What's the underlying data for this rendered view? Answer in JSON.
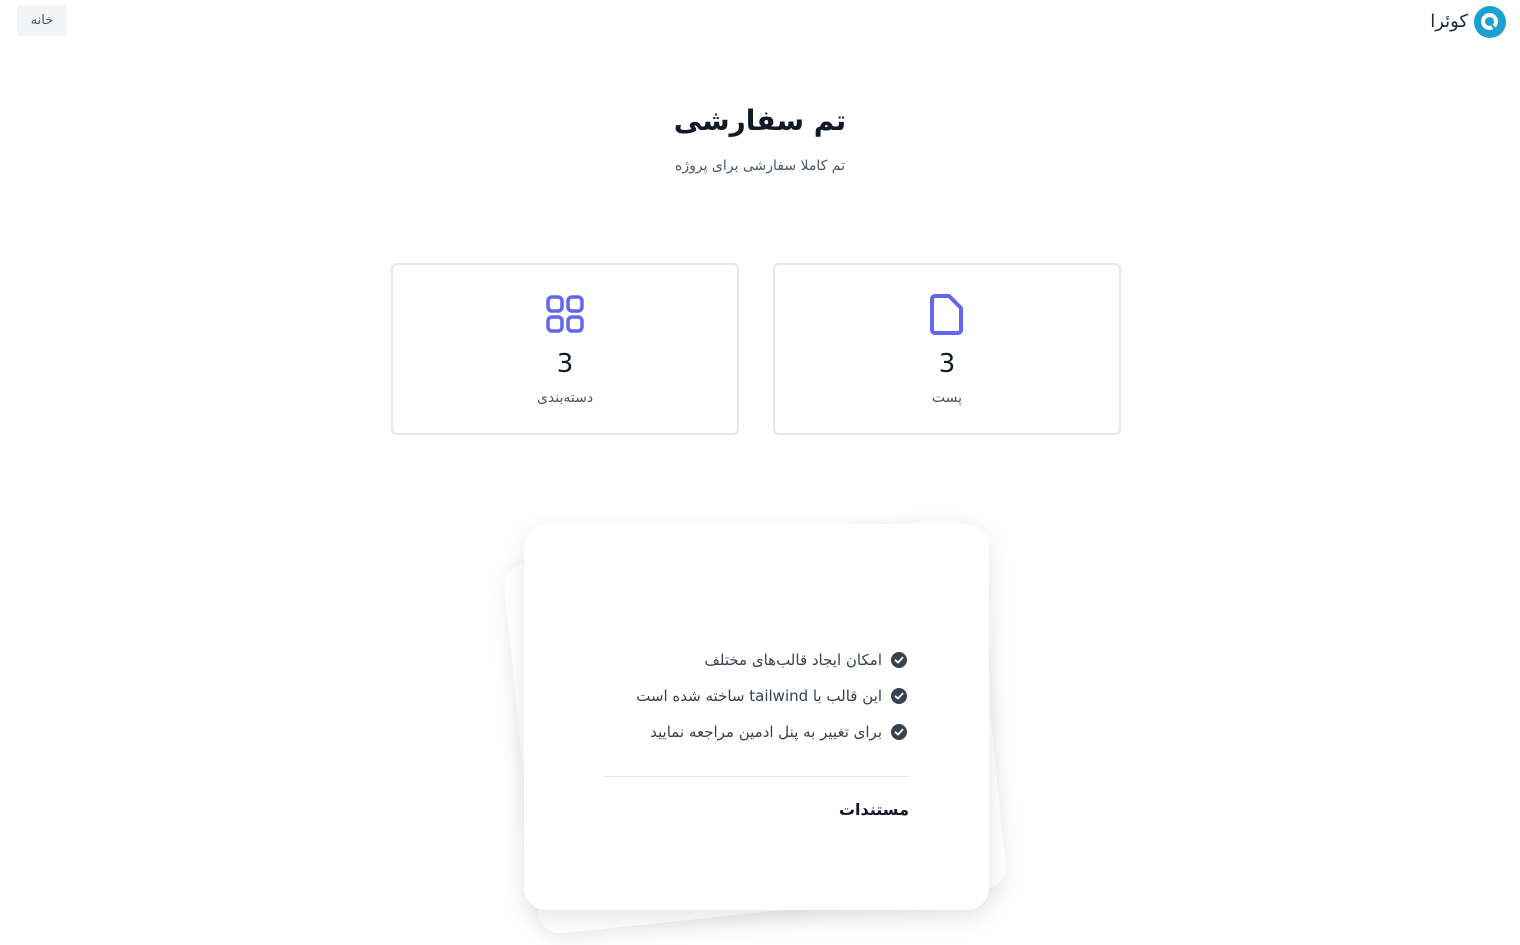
{
  "header": {
    "brand_name": "کوئرا",
    "brand_logo_icon": "quera-logo-icon",
    "home_label": "خانه"
  },
  "hero": {
    "title": "تم سفارشی",
    "subtitle": "تم کاملا سفارشی برای پروژه"
  },
  "stats": [
    {
      "label": "پست",
      "count": "3",
      "icon": "document-icon"
    },
    {
      "label": "دسته‌بندی",
      "count": "3",
      "icon": "grid-icon"
    }
  ],
  "features": {
    "items": [
      "امکان ایجاد قالب‌های مختلف",
      "این قالب با tailwind ساخته شده است",
      "برای تغییر به پنل ادمین مراجعه نمایید"
    ],
    "icon": "check-circle-icon"
  },
  "docs": {
    "label": "مستندات"
  },
  "colors": {
    "accent": "#6366f1",
    "brand": "#1ba0d4",
    "check": "#374151",
    "border": "#e5e7eb",
    "button_bg": "#f3f4f6"
  }
}
